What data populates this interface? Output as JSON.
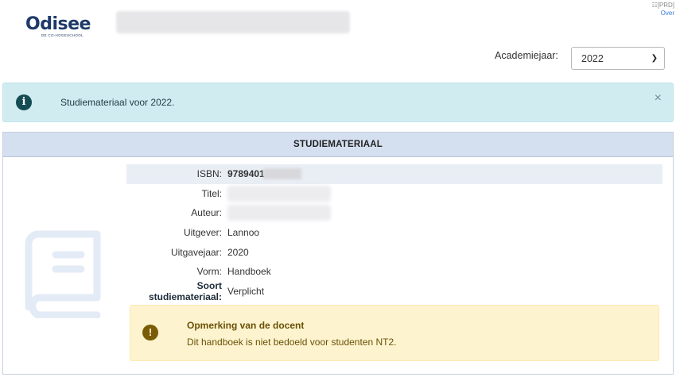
{
  "header": {
    "logo_text": "Odisee",
    "logo_subtitle": "DE CO-HOGESCHOOL",
    "env_label": "[PRD]",
    "over_link": "Over"
  },
  "filters": {
    "year_label": "Academiejaar:",
    "year_value": "2022"
  },
  "alert": {
    "text": "Studiemateriaal voor 2022.",
    "close": "×"
  },
  "panel": {
    "title": "STUDIEMATERIAAL",
    "rows": [
      {
        "label": "ISBN:",
        "value": "9789401"
      },
      {
        "label": "Titel:",
        "value": ""
      },
      {
        "label": "Auteur:",
        "value": ""
      },
      {
        "label": "Uitgever:",
        "value": "Lannoo"
      },
      {
        "label": "Uitgavejaar:",
        "value": "2020"
      },
      {
        "label": "Vorm:",
        "value": "Handboek"
      },
      {
        "label": "Soort studiemateriaal:",
        "value": "Verplicht"
      }
    ]
  },
  "remark": {
    "title": "Opmerking van de docent",
    "text": "Dit handboek is niet bedoeld voor studenten NT2."
  },
  "colors": {
    "brand": "#1f3a68",
    "info_bg": "#d1ecf1",
    "warning_bg": "#fdf3cf",
    "panel_header_bg": "#d4dff0"
  }
}
